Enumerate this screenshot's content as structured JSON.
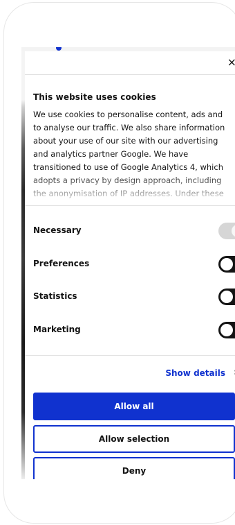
{
  "dialog": {
    "close_glyph": "×",
    "title": "This website uses cookies",
    "body": "We use cookies to personalise content, ads and to analyse our traffic. We also share information about your use of our site with our advertising and analytics partner Google. We have transitioned to use of Google Analytics 4, which adopts a privacy by design approach, including the anonymisation of IP addresses. Under these"
  },
  "toggles": [
    {
      "label": "Necessary",
      "state": "on-disabled"
    },
    {
      "label": "Preferences",
      "state": "off"
    },
    {
      "label": "Statistics",
      "state": "off"
    },
    {
      "label": "Marketing",
      "state": "off"
    }
  ],
  "details": {
    "label": "Show details",
    "chevron": "›"
  },
  "buttons": {
    "allow_all": "Allow all",
    "allow_selection": "Allow selection",
    "deny": "Deny"
  },
  "colors": {
    "accent": "#1032cf",
    "text": "#141414",
    "toggle_off": "#141414",
    "toggle_disabled": "#d6d6d6"
  }
}
